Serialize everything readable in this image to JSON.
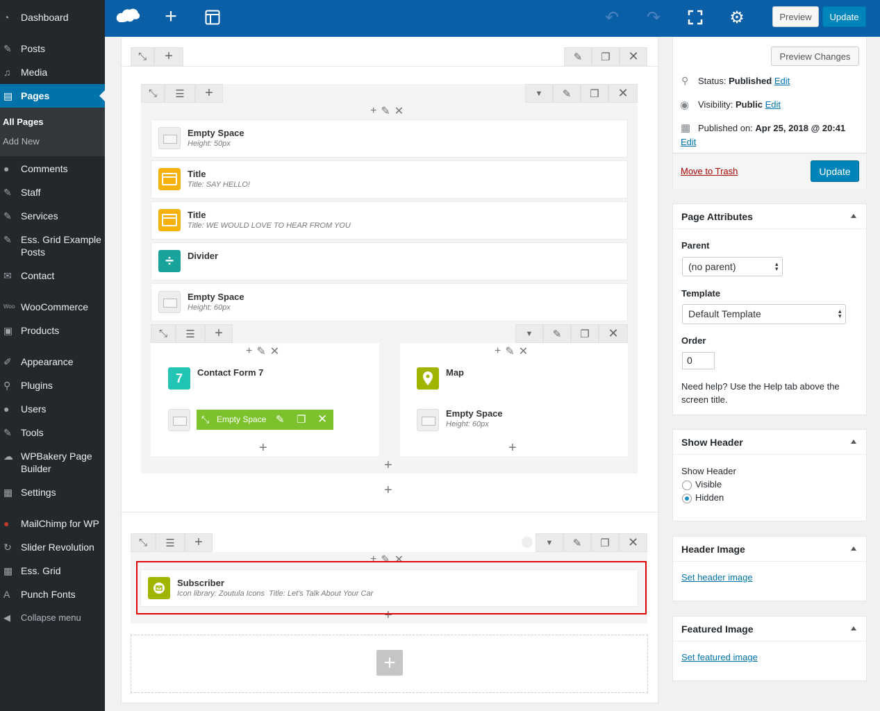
{
  "sidebar": {
    "items": [
      {
        "label": "Dashboard",
        "icon": "dashboard-icon"
      },
      {
        "label": "Posts",
        "icon": "pin-icon"
      },
      {
        "label": "Media",
        "icon": "media-icon"
      },
      {
        "label": "Pages",
        "icon": "pages-icon"
      },
      {
        "label": "Comments",
        "icon": "comments-icon"
      },
      {
        "label": "Staff",
        "icon": "pin-icon"
      },
      {
        "label": "Services",
        "icon": "pin-icon"
      },
      {
        "label": "Ess. Grid Example Posts",
        "icon": "pin-icon"
      },
      {
        "label": "Contact",
        "icon": "mail-icon"
      },
      {
        "label": "WooCommerce",
        "icon": "woo-icon"
      },
      {
        "label": "Products",
        "icon": "box-icon"
      },
      {
        "label": "Appearance",
        "icon": "brush-icon"
      },
      {
        "label": "Plugins",
        "icon": "plug-icon"
      },
      {
        "label": "Users",
        "icon": "user-icon"
      },
      {
        "label": "Tools",
        "icon": "wrench-icon"
      },
      {
        "label": "WPBakery Page Builder",
        "icon": "cloud-icon"
      },
      {
        "label": "Settings",
        "icon": "sliders-icon"
      },
      {
        "label": "MailChimp for WP",
        "icon": "mailchimp-icon"
      },
      {
        "label": "Slider Revolution",
        "icon": "refresh-icon"
      },
      {
        "label": "Ess. Grid",
        "icon": "grid-icon"
      },
      {
        "label": "Punch Fonts",
        "icon": "font-icon"
      },
      {
        "label": "Collapse menu",
        "icon": "collapse-icon"
      }
    ],
    "submenu": [
      "All Pages",
      "Add New"
    ]
  },
  "topbar": {
    "preview": "Preview",
    "update": "Update"
  },
  "builder": {
    "elements": [
      {
        "name": "Empty Space",
        "desc": "Height: 50px"
      },
      {
        "name": "Title",
        "desc": "Title: SAY HELLO!"
      },
      {
        "name": "Title",
        "desc": "Title: WE WOULD LOVE TO HEAR FROM YOU"
      },
      {
        "name": "Divider",
        "desc": ""
      },
      {
        "name": "Empty Space",
        "desc": "Height: 60px"
      }
    ],
    "col_left": {
      "contact": "Contact Form 7",
      "icon_text": "7",
      "active_el": "Empty Space"
    },
    "col_right": {
      "map": "Map",
      "space": "Empty Space",
      "space_desc": "Height: 60px"
    },
    "subscriber": {
      "name": "Subscriber",
      "desc": "Icon library: Zoutula Icons  Title: Let's Talk About Your Car"
    },
    "highlight_color": "#e00000"
  },
  "publish": {
    "preview_changes": "Preview Changes",
    "status_label": "Status:",
    "status_value": "Published",
    "visibility_label": "Visibility:",
    "visibility_value": "Public",
    "published_label": "Published on:",
    "published_value": "Apr 25, 2018 @ 20:41",
    "edit": "Edit",
    "trash": "Move to Trash",
    "update": "Update"
  },
  "page_attributes": {
    "title": "Page Attributes",
    "parent_label": "Parent",
    "parent_value": "(no parent)",
    "template_label": "Template",
    "template_value": "Default Template",
    "order_label": "Order",
    "order_value": "0",
    "help": "Need help? Use the Help tab above the screen title."
  },
  "show_header": {
    "title": "Show Header",
    "label": "Show Header",
    "opt_visible": "Visible",
    "opt_hidden": "Hidden",
    "selected": "Hidden"
  },
  "header_image": {
    "title": "Header Image",
    "link": "Set header image"
  },
  "featured_image": {
    "title": "Featured Image",
    "link": "Set featured image"
  }
}
